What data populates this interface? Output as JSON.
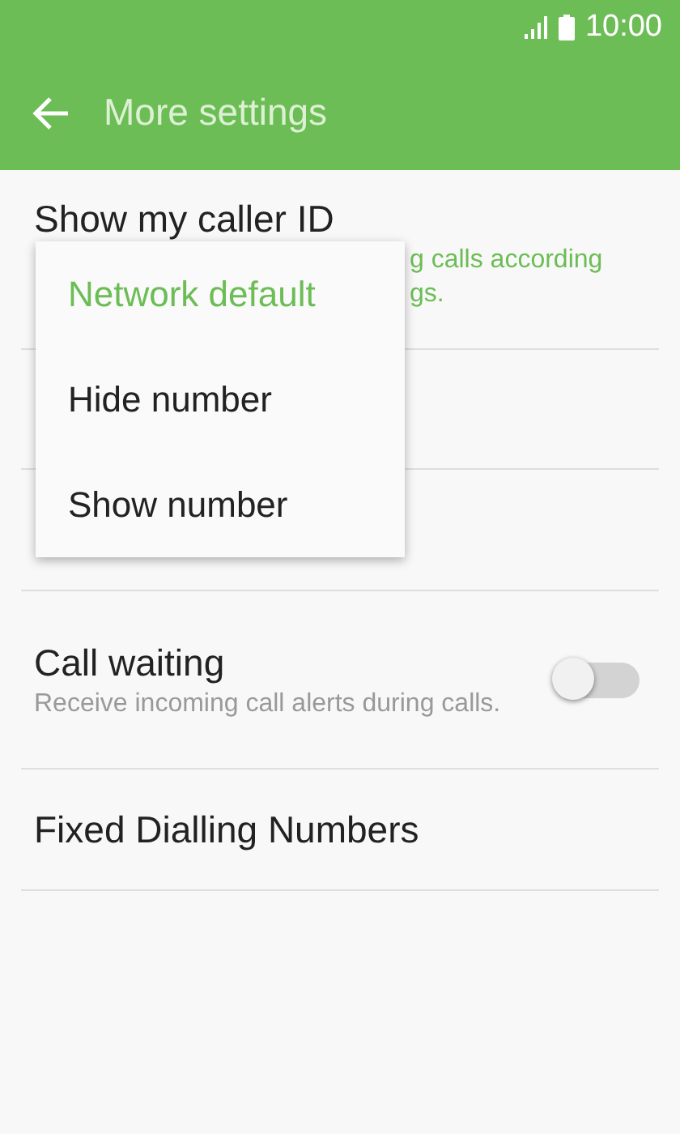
{
  "status_bar": {
    "time": "10:00"
  },
  "header": {
    "title": "More settings"
  },
  "settings": [
    {
      "kind": "covered",
      "title": "Show my caller ID",
      "subtitle_lines": [
        "g calls according",
        "gs."
      ]
    },
    {
      "kind": "hidden"
    },
    {
      "kind": "hidden"
    },
    {
      "kind": "switch",
      "title": "Call waiting",
      "subtitle": "Receive incoming call alerts during calls.",
      "on": false
    },
    {
      "kind": "plain",
      "title": "Fixed Dialling Numbers"
    }
  ],
  "popup_menu": [
    {
      "label": "Network default",
      "selected": true
    },
    {
      "label": "Hide number",
      "selected": false
    },
    {
      "label": "Show number",
      "selected": false
    }
  ]
}
